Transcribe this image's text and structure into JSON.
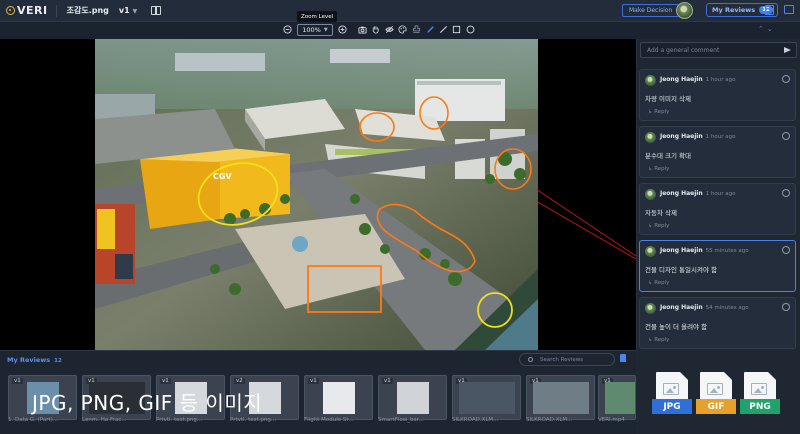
{
  "app": {
    "logo": "VERI",
    "filename": "조감도.png",
    "version": "v1"
  },
  "header": {
    "make_decision": "Make Decision",
    "my_reviews": "My Reviews",
    "my_reviews_count": "12"
  },
  "toolbar": {
    "tooltip": "Zoom Level",
    "zoom": "100%"
  },
  "comments": {
    "placeholder": "Add a general comment",
    "items": [
      {
        "author": "Jeong Haejin",
        "time": "1 hour ago",
        "text": "차량 이미지 삭제",
        "reply": "Reply"
      },
      {
        "author": "Jeong Haejin",
        "time": "1 hour ago",
        "text": "분수대 크기 확대",
        "reply": "Reply"
      },
      {
        "author": "Jeong Haejin",
        "time": "1 hour ago",
        "text": "자동차 삭제",
        "reply": "Reply"
      },
      {
        "author": "Jeong Haejin",
        "time": "55 minutes ago",
        "text": "건물 디자인 통일시켜야 함",
        "reply": "Reply"
      },
      {
        "author": "Jeong Haejin",
        "time": "54 minutes ago",
        "text": "건물 높이 더 올려야 함",
        "reply": "Reply"
      }
    ]
  },
  "reviews": {
    "title": "My Reviews",
    "count": "12",
    "search_placeholder": "Search Reviews",
    "thumbs": [
      {
        "ver": "v1",
        "label": "1. Data G. (Part)..."
      },
      {
        "ver": "v1",
        "label": "Lenm. Ha Frac..."
      },
      {
        "ver": "v1",
        "label": "Prtvtl. test.png..."
      },
      {
        "ver": "v2",
        "label": "Prtvtl. test.png..."
      },
      {
        "ver": "v1",
        "label": "Flight Module St..."
      },
      {
        "ver": "v1",
        "label": "SmartFlow_bar..."
      },
      {
        "ver": "v1",
        "label": "SILKROAD.XLM..."
      },
      {
        "ver": "v1",
        "label": "SILKROAD.XLM..."
      },
      {
        "ver": "v1",
        "label": "VERI.mp4"
      }
    ]
  },
  "overlay_text": "JPG, PNG, GIF 등 이미지",
  "file_types": [
    {
      "label": "JPG",
      "color": "#2f6fd6"
    },
    {
      "label": "GIF",
      "color": "#e5a12a"
    },
    {
      "label": "PNG",
      "color": "#1fa36b"
    }
  ],
  "icons": {
    "logo": "veri-logo-icon",
    "panel_toggle": "panel-toggle-icon",
    "zoom_out": "zoom-out-icon",
    "zoom_in": "zoom-in-icon",
    "camera": "camera-icon",
    "hand": "hand-icon",
    "hide": "eye-off-icon",
    "palette": "palette-icon",
    "stamp": "stamp-icon",
    "pen": "pen-icon",
    "line": "line-icon",
    "rect": "rectangle-icon",
    "circle": "circle-icon",
    "calendar": "calendar-icon",
    "chat": "chat-icon",
    "send": "send-icon"
  },
  "colors": {
    "accent": "#3f7ef0",
    "annotation_yellow": "#f2e01c",
    "annotation_orange": "#ff7a12",
    "arrow_red": "#d81818"
  }
}
